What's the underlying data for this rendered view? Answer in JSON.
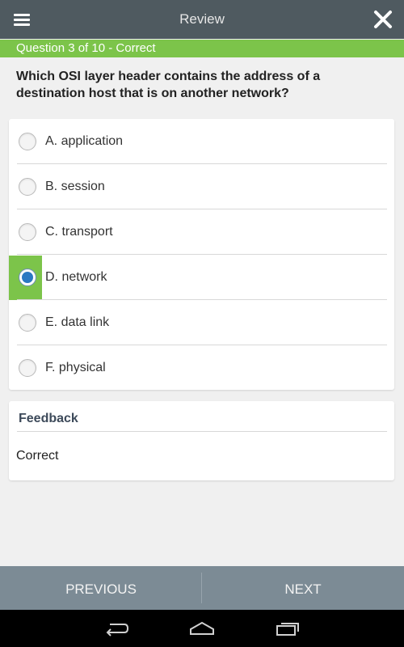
{
  "header": {
    "title": "Review",
    "menu_icon": "hamburger-menu-icon",
    "close_icon": "close-icon"
  },
  "status": {
    "text": "Question 3 of 10 - Correct",
    "color": "#7cc44a"
  },
  "question": {
    "text": "Which OSI layer header contains the address of a destination host that is on another network?"
  },
  "options": [
    {
      "label": "A. application",
      "selected": false
    },
    {
      "label": "B. session",
      "selected": false
    },
    {
      "label": "C. transport",
      "selected": false
    },
    {
      "label": "D. network",
      "selected": true
    },
    {
      "label": "E. data link",
      "selected": false
    },
    {
      "label": "F. physical",
      "selected": false
    }
  ],
  "feedback": {
    "title": "Feedback",
    "text": "Correct"
  },
  "navigation": {
    "previous_label": "PREVIOUS",
    "next_label": "NEXT"
  },
  "system_bar": {
    "icons": [
      "back-icon",
      "home-icon",
      "recent-apps-icon"
    ]
  },
  "colors": {
    "header": "#4f5a60",
    "accent_green": "#7cc44a",
    "bottom_nav": "#7c8b95",
    "radio_selected": "#2a78c2"
  }
}
